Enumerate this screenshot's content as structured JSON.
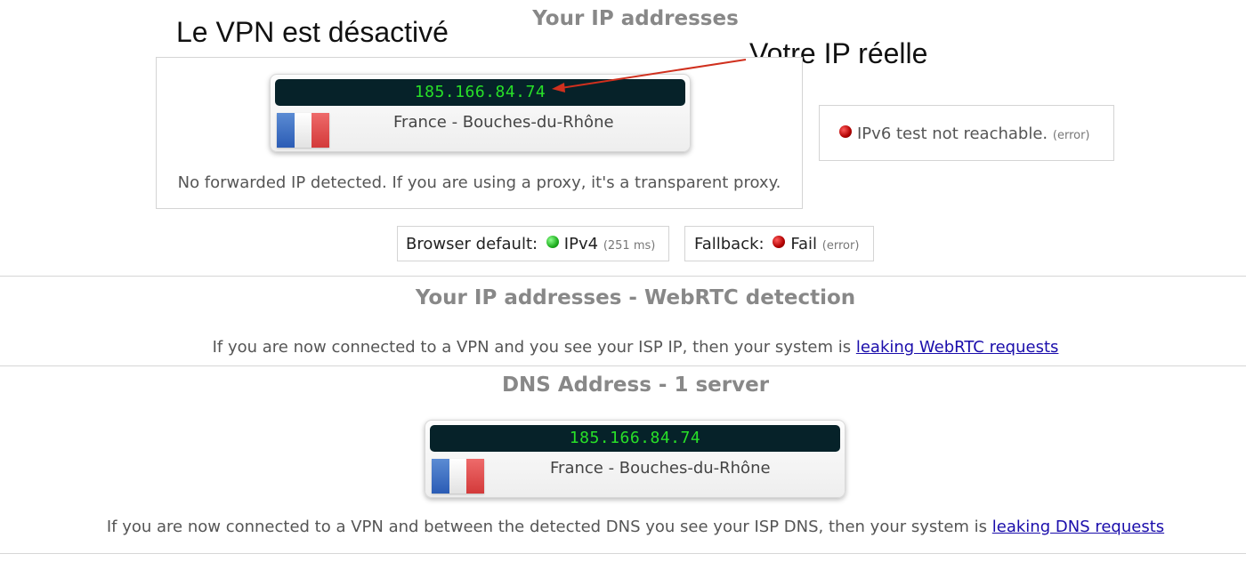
{
  "annotations": {
    "vpn_status": "Le VPN est désactivé",
    "real_ip_label": "Votre IP réelle"
  },
  "ip_section": {
    "title": "Your IP addresses",
    "ipv4": {
      "ip": "185.166.84.74",
      "location": "France - Bouches-du-Rhône",
      "flag_icon": "flag-france-icon"
    },
    "forwarded_note": "No forwarded IP detected. If you are using a proxy, it's a transparent proxy.",
    "ipv6": {
      "message": "IPv6 test not reachable.",
      "status": "(error)",
      "indicator_color": "#c00000"
    },
    "browser_default": {
      "label": "Browser default:",
      "protocol": "IPv4",
      "latency": "(251 ms)",
      "indicator_color": "#1fae1f"
    },
    "fallback": {
      "label": "Fallback:",
      "result": "Fail",
      "status": "(error)",
      "indicator_color": "#c00000"
    }
  },
  "webrtc_section": {
    "title": "Your IP addresses - WebRTC detection",
    "note_prefix": "If you are now connected to a VPN and you see your ISP IP, then your system is",
    "note_link": "leaking WebRTC requests"
  },
  "dns_section": {
    "title": "DNS Address - 1 server",
    "server": {
      "ip": "185.166.84.74",
      "location": "France - Bouches-du-Rhône",
      "flag_icon": "flag-france-icon"
    },
    "note_prefix": "If you are now connected to a VPN and between the detected DNS you see your ISP DNS, then your system is",
    "note_link": "leaking DNS requests"
  },
  "colors": {
    "ip_bar_bg": "#062229",
    "ip_text": "#28e028",
    "annotation_arrow": "#d0301e",
    "link": "#1a0dab"
  }
}
